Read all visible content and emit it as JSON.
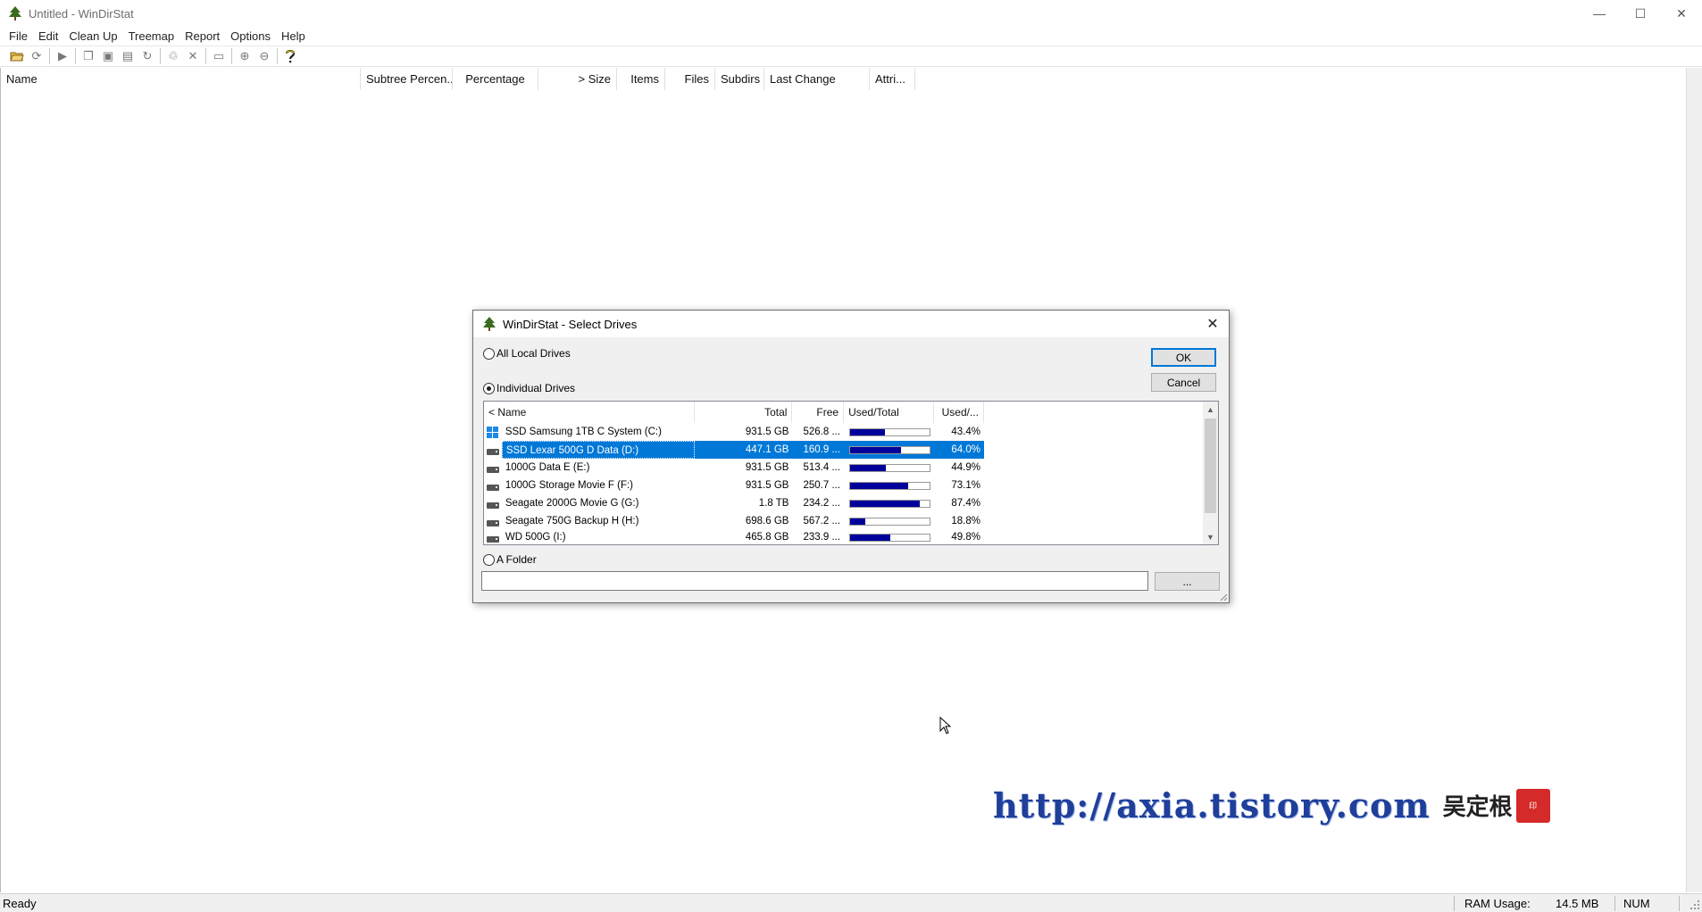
{
  "window": {
    "title": "Untitled - WinDirStat",
    "minimize": "—",
    "maximize": "☐",
    "close": "✕"
  },
  "menu": [
    "File",
    "Edit",
    "Clean Up",
    "Treemap",
    "Report",
    "Options",
    "Help"
  ],
  "toolbar": {
    "icons": [
      "open-icon",
      "refresh-icon",
      "play-icon",
      "copy-icon",
      "copy-path-icon",
      "explorer-icon",
      "refresh-selected-icon",
      "recycle-bin-icon",
      "delete-icon",
      "new-folder-icon",
      "zoom-in-icon",
      "zoom-out-icon",
      "help-icon"
    ]
  },
  "main_list": {
    "columns": [
      "Name",
      "Subtree Percen...",
      "Percentage",
      "> Size",
      "Items",
      "Files",
      "Subdirs",
      "Last Change",
      "Attri..."
    ]
  },
  "status": {
    "text": "Ready",
    "ram_label": "RAM Usage:",
    "ram_value": "14.5 MB",
    "num": "NUM"
  },
  "dialog": {
    "title": "WinDirStat - Select Drives",
    "close": "✕",
    "ok_label": "OK",
    "cancel_label": "Cancel",
    "browse_label": "...",
    "radio_all": "All Local Drives",
    "radio_individual": "Individual Drives",
    "radio_folder": "A Folder",
    "folder_value": "",
    "columns": {
      "name": "< Name",
      "total": "Total",
      "free": "Free",
      "used_total": "Used/Total",
      "used_pct": "Used/..."
    },
    "drives": [
      {
        "name": "SSD Samsung 1TB C System (C:)",
        "total": "931.5 GB",
        "free": "526.8 ...",
        "used": 0.434,
        "pct": "43.4%",
        "icon": "windows-drive-icon",
        "selected": false
      },
      {
        "name": "SSD Lexar 500G D Data (D:)",
        "total": "447.1 GB",
        "free": "160.9 ...",
        "used": 0.64,
        "pct": "64.0%",
        "icon": "drive-icon",
        "selected": true
      },
      {
        "name": "1000G Data E (E:)",
        "total": "931.5 GB",
        "free": "513.4 ...",
        "used": 0.449,
        "pct": "44.9%",
        "icon": "drive-icon",
        "selected": false
      },
      {
        "name": "1000G Storage Movie F (F:)",
        "total": "931.5 GB",
        "free": "250.7 ...",
        "used": 0.731,
        "pct": "73.1%",
        "icon": "drive-icon",
        "selected": false
      },
      {
        "name": "Seagate 2000G Movie G  (G:)",
        "total": "1.8 TB",
        "free": "234.2 ...",
        "used": 0.874,
        "pct": "87.4%",
        "icon": "drive-icon",
        "selected": false
      },
      {
        "name": "Seagate 750G Backup H (H:)",
        "total": "698.6 GB",
        "free": "567.2 ...",
        "used": 0.188,
        "pct": "18.8%",
        "icon": "drive-icon",
        "selected": false
      },
      {
        "name": "WD 500G (I:)",
        "total": "465.8 GB",
        "free": "233.9 ...",
        "used": 0.498,
        "pct": "49.8%",
        "icon": "drive-icon",
        "selected": false
      }
    ]
  },
  "watermark": {
    "url": "http://axia.tistory.com",
    "name": "吴定根",
    "seal": "印"
  }
}
